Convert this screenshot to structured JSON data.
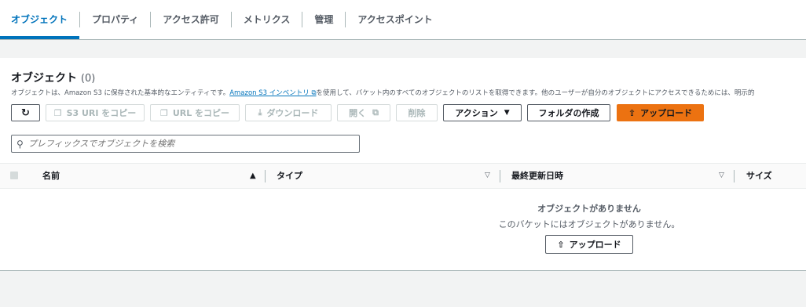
{
  "tabs": [
    {
      "label": "オブジェクト",
      "active": true
    },
    {
      "label": "プロパティ"
    },
    {
      "label": "アクセス許可"
    },
    {
      "label": "メトリクス"
    },
    {
      "label": "管理"
    },
    {
      "label": "アクセスポイント"
    }
  ],
  "objects": {
    "title": "オブジェクト",
    "count": "(0)",
    "description_prefix": "オブジェクトは、Amazon S3 に保存された基本的なエンティティです。",
    "description_link": "Amazon S3 インベントリ",
    "description_suffix": "を使用して、バケット内のすべてのオブジェクトのリストを取得できます。他のユーザーが自分のオブジェクトにアクセスできるためには、明示的"
  },
  "toolbar": {
    "copy_s3_uri": "S3 URI をコピー",
    "copy_url": "URL をコピー",
    "download": "ダウンロード",
    "open": "開く",
    "delete": "削除",
    "actions": "アクション",
    "create_folder": "フォルダの作成",
    "upload": "アップロード"
  },
  "search": {
    "placeholder": "プレフィックスでオブジェクトを検索"
  },
  "table": {
    "columns": [
      "名前",
      "タイプ",
      "最終更新日時",
      "サイズ"
    ]
  },
  "empty": {
    "title": "オブジェクトがありません",
    "description": "このバケットにはオブジェクトがありません。",
    "upload_label": "アップロード"
  },
  "colors": {
    "accent": "#0073bb",
    "primary_button": "#ec7211",
    "background": "#f2f3f3"
  }
}
